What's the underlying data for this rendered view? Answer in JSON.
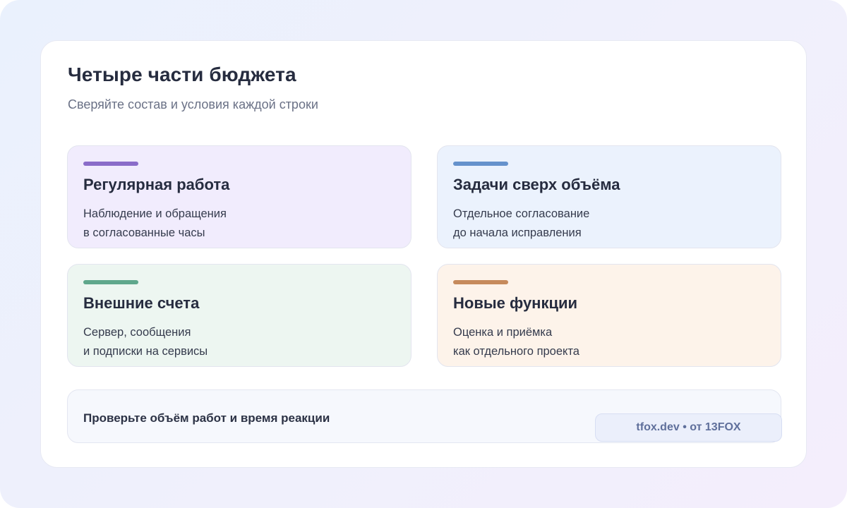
{
  "header": {
    "title": "Четыре части бюджета",
    "subtitle": "Сверяйте состав и условия каждой строки"
  },
  "cards": [
    {
      "title": "Регулярная работа",
      "line1": "Наблюдение и обращения",
      "line2": "в согласованные часы",
      "accent": "#8a6cc9",
      "background": "#f1ecfd"
    },
    {
      "title": "Задачи сверх объёма",
      "line1": "Отдельное согласование",
      "line2": "до начала исправления",
      "accent": "#6592cc",
      "background": "#ebf2fd"
    },
    {
      "title": "Внешние счета",
      "line1": "Сервер, сообщения",
      "line2": "и подписки на сервисы",
      "accent": "#5fa78c",
      "background": "#edf6f1"
    },
    {
      "title": "Новые функции",
      "line1": "Оценка и приёмка",
      "line2": "как отдельного проекта",
      "accent": "#c68a5c",
      "background": "#fdf3ea"
    }
  ],
  "footer": {
    "note": "Проверьте объём работ и время реакции",
    "brand": "tfox.dev • от 13FOX"
  }
}
